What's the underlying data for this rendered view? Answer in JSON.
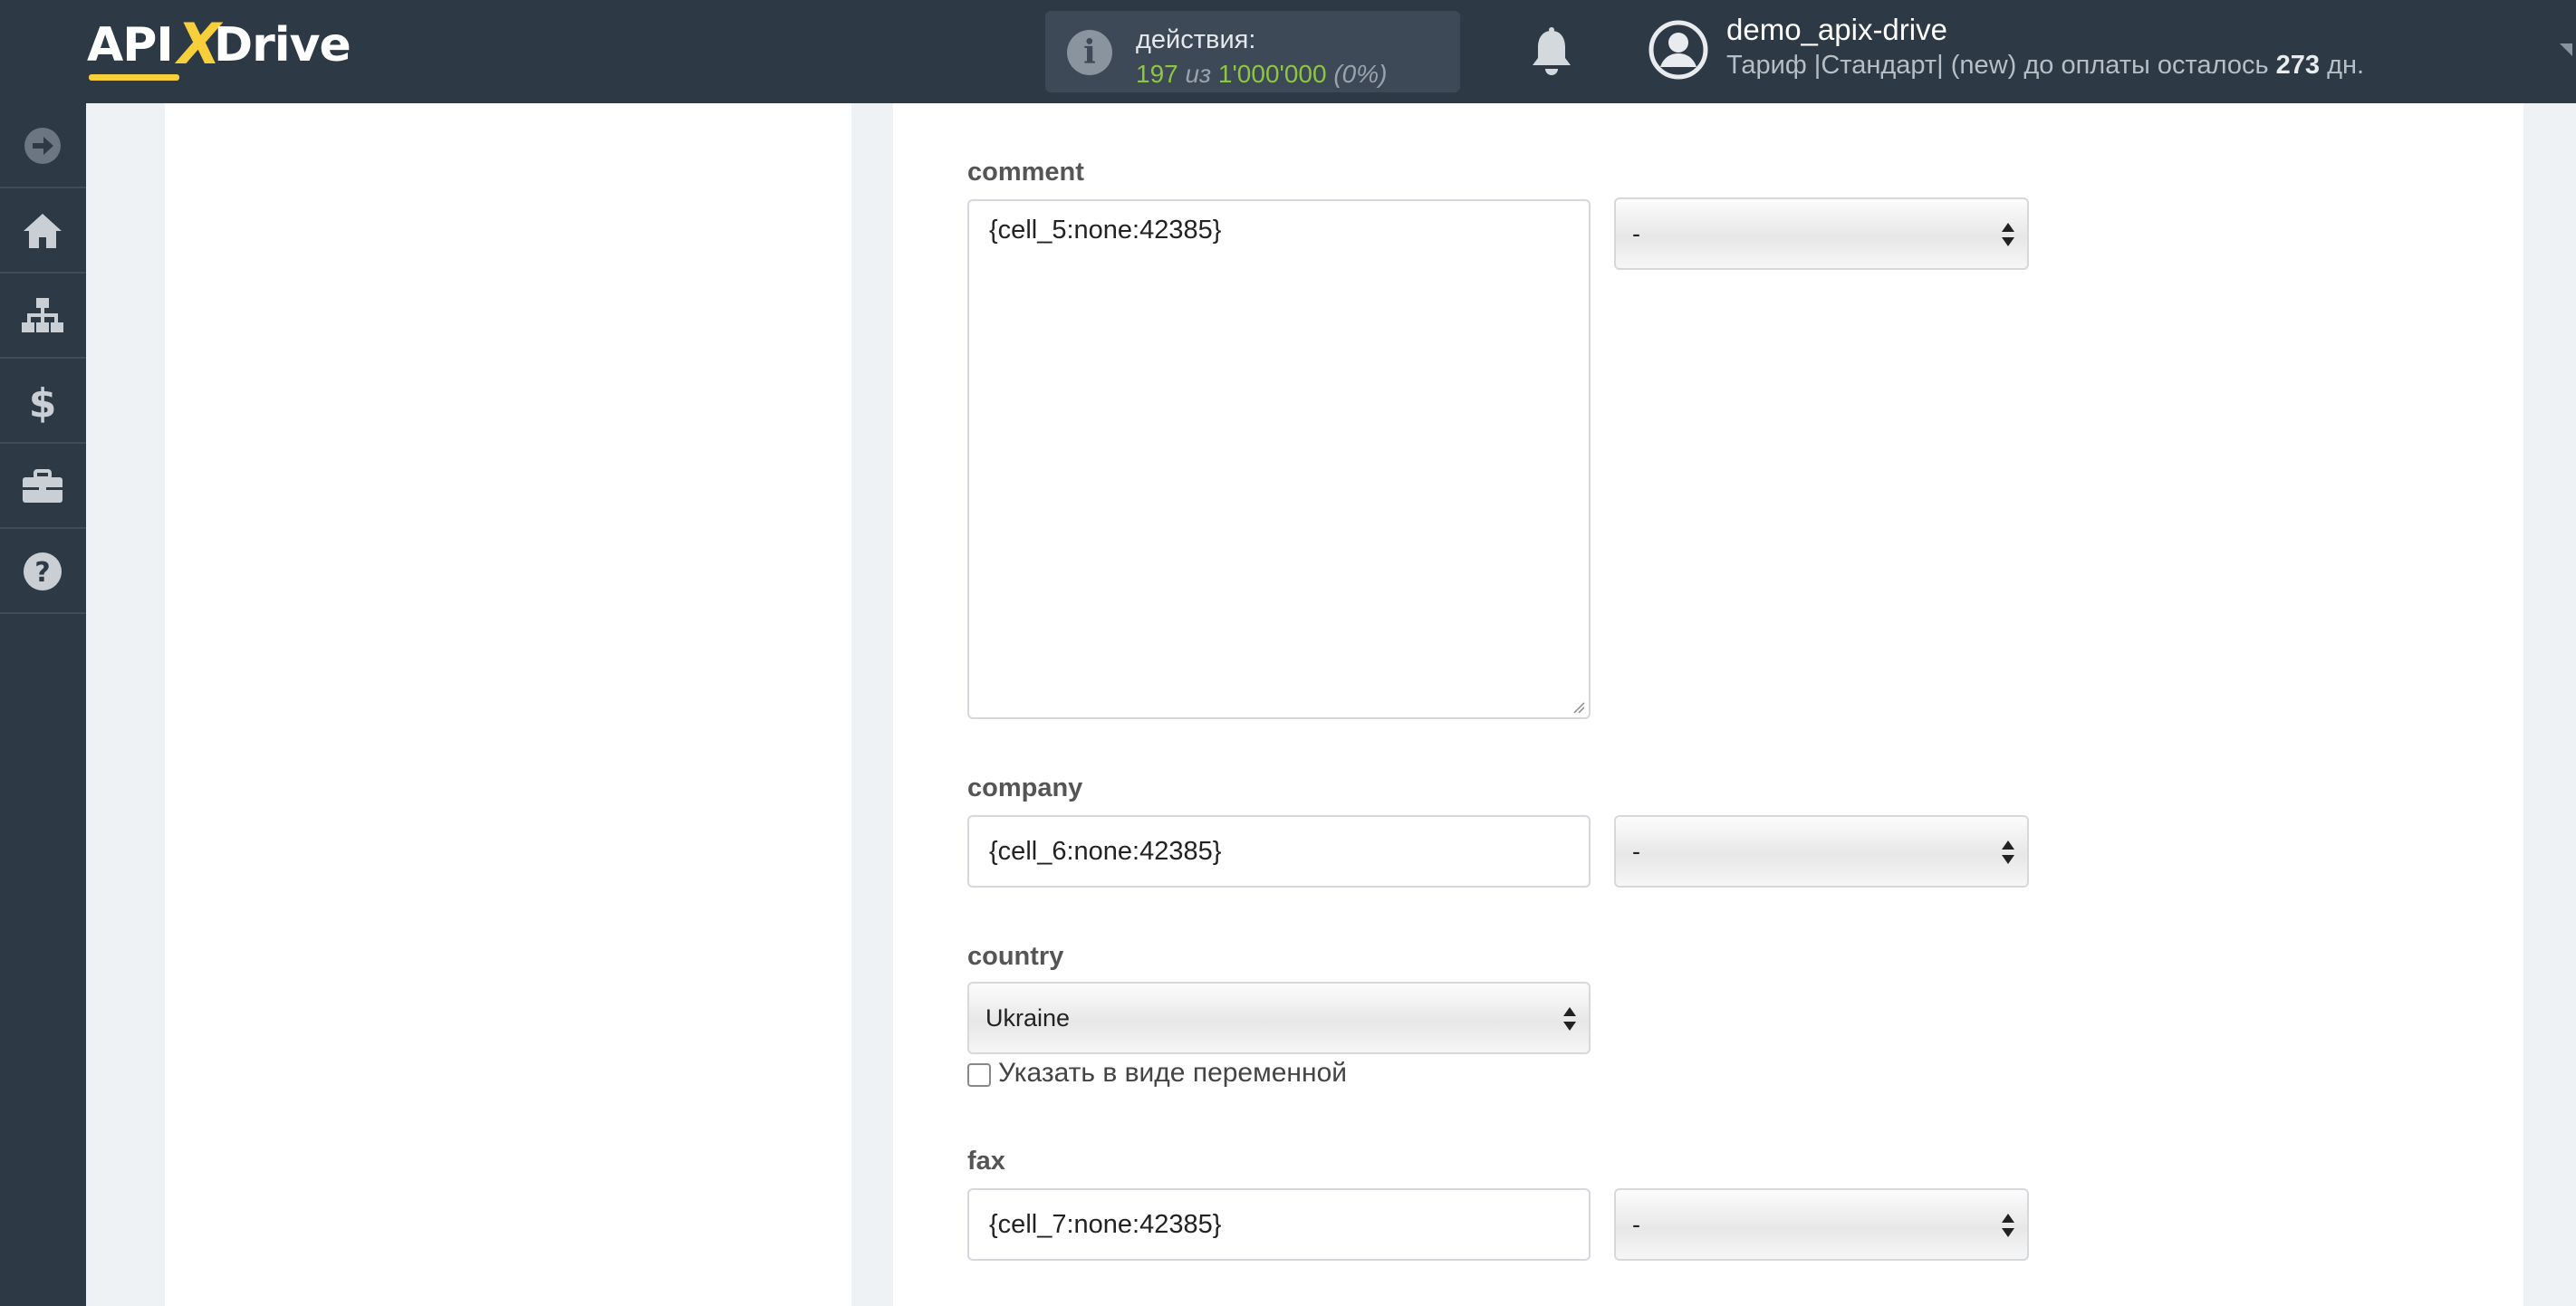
{
  "header": {
    "logo": {
      "part1": "API",
      "part2": "X",
      "part3": "Drive"
    },
    "actions": {
      "label": "действия:",
      "used": "197",
      "of": "из",
      "limit": "1'000'000",
      "percent": "(0%)"
    },
    "user": {
      "name": "demo_apix-drive",
      "plan_prefix": "Тариф |Стандарт| (new) до оплаты осталось",
      "days": "273",
      "days_suffix": "дн."
    }
  },
  "sidebar": {
    "items": [
      {
        "icon": "arrow-right-circle-icon"
      },
      {
        "icon": "home-icon"
      },
      {
        "icon": "sitemap-icon"
      },
      {
        "icon": "dollar-icon"
      },
      {
        "icon": "briefcase-icon"
      },
      {
        "icon": "question-circle-icon"
      }
    ]
  },
  "form": {
    "comment": {
      "label": "comment",
      "value": "{cell_5:none:42385}",
      "select": "-"
    },
    "company": {
      "label": "company",
      "value": "{cell_6:none:42385}",
      "select": "-"
    },
    "country": {
      "label": "country",
      "value": "Ukraine",
      "checkbox_label": "Указать в виде переменной"
    },
    "fax": {
      "label": "fax",
      "value": "{cell_7:none:42385}",
      "select": "-"
    }
  }
}
